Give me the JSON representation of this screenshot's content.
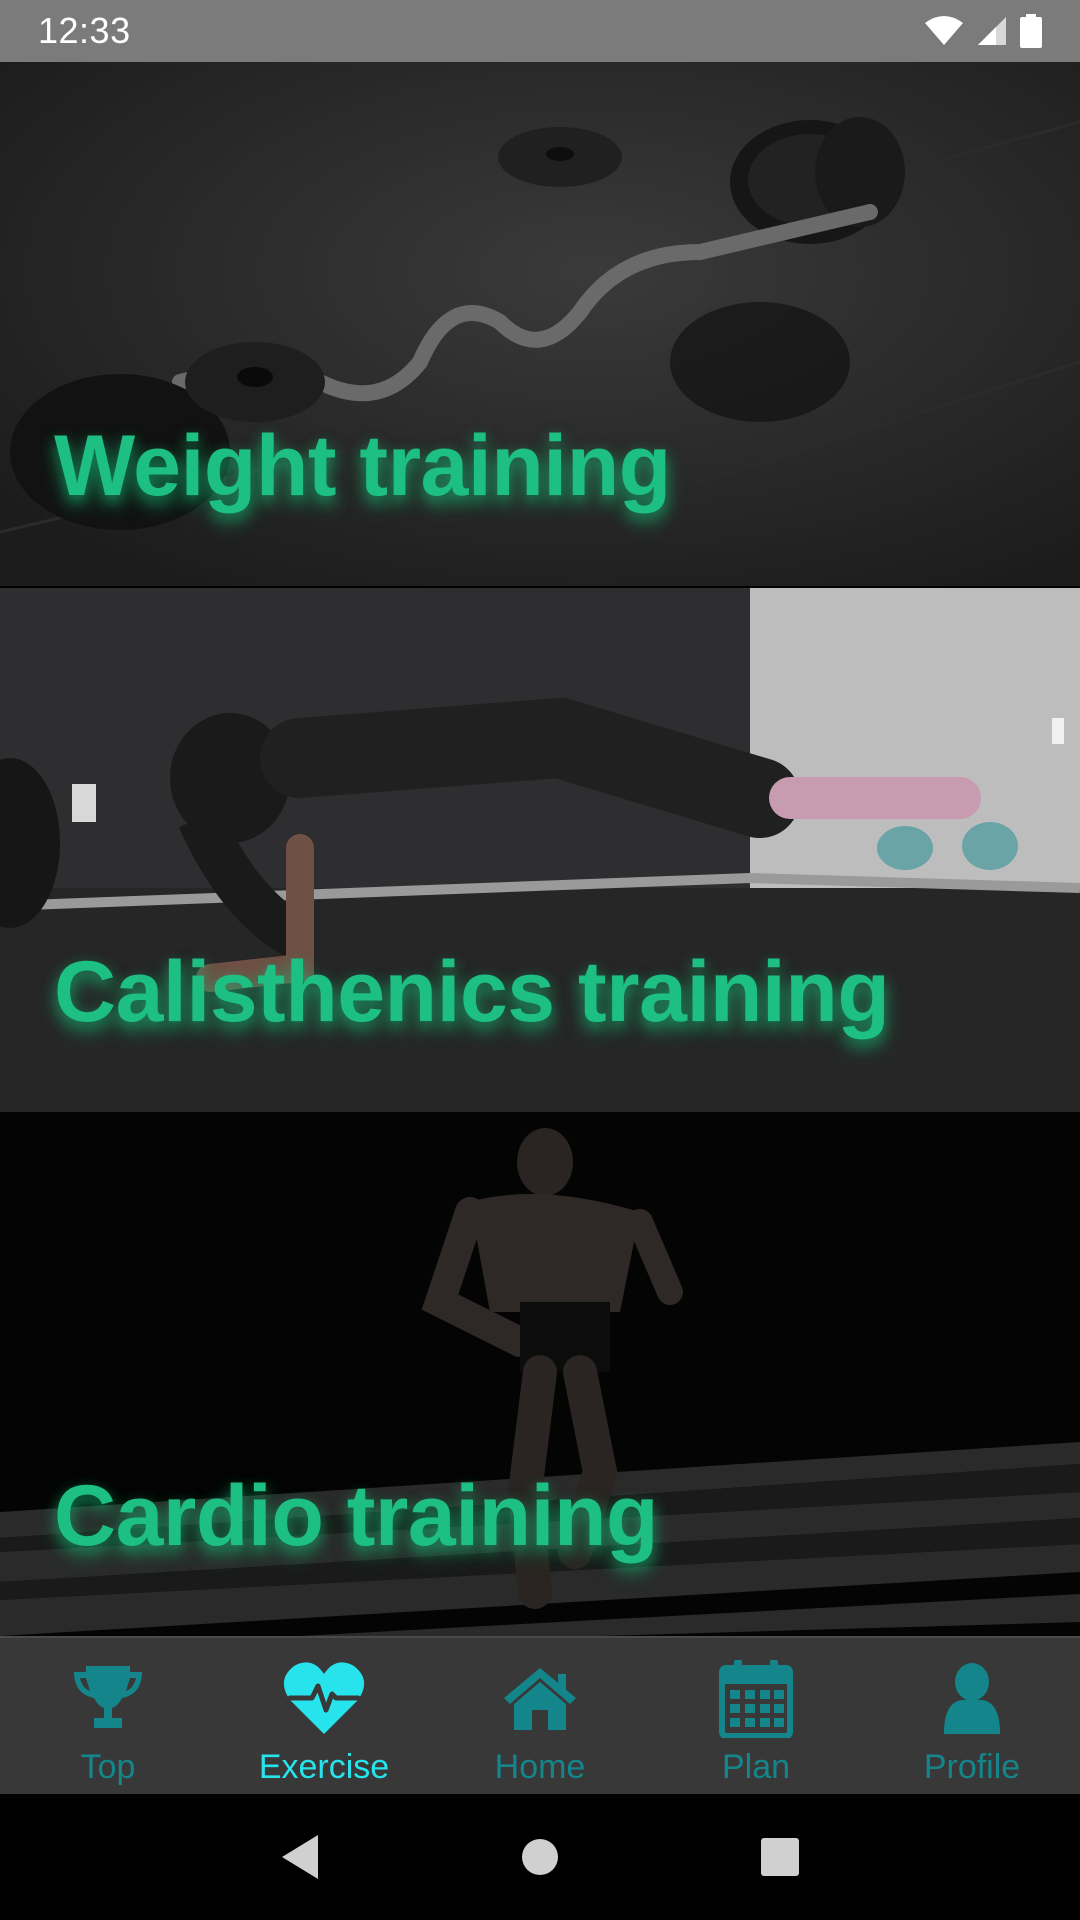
{
  "status_bar": {
    "time": "12:33",
    "icons": [
      "wifi-icon",
      "signal-icon",
      "battery-icon"
    ]
  },
  "cards": [
    {
      "title": "Weight training",
      "image": "barbell-on-floor"
    },
    {
      "title": "Calisthenics training",
      "image": "woman-plank"
    },
    {
      "title": "Cardio training",
      "image": "man-running"
    }
  ],
  "bottom_nav": {
    "items": [
      {
        "label": "Top",
        "icon": "trophy-icon",
        "active": false
      },
      {
        "label": "Exercise",
        "icon": "heartbeat-icon",
        "active": true
      },
      {
        "label": "Home",
        "icon": "home-icon",
        "active": false
      },
      {
        "label": "Plan",
        "icon": "calendar-icon",
        "active": false
      },
      {
        "label": "Profile",
        "icon": "person-icon",
        "active": false
      }
    ]
  },
  "colors": {
    "title_green": "#1dbf83",
    "nav_inactive": "#14868b",
    "nav_active": "#27e3ec",
    "nav_background": "#383838",
    "status_bar": "#7b7b7b"
  },
  "system_nav": [
    "back-button",
    "home-button",
    "recents-button"
  ]
}
